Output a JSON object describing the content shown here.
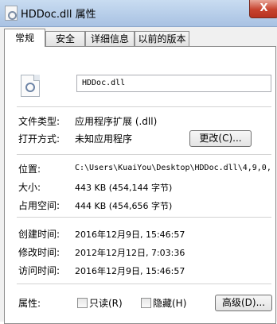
{
  "window": {
    "title": "HDDoc.dll 属性",
    "close_glyph": "X"
  },
  "tabs": [
    {
      "label": "常规",
      "active": true
    },
    {
      "label": "安全",
      "active": false
    },
    {
      "label": "详细信息",
      "active": false
    },
    {
      "label": "以前的版本",
      "active": false
    }
  ],
  "general": {
    "filename": "HDDoc.dll",
    "file_type_label": "文件类型:",
    "file_type_value": "应用程序扩展 (.dll)",
    "opens_with_label": "打开方式:",
    "opens_with_value": "未知应用程序",
    "change_button": "更改(C)...",
    "location_label": "位置:",
    "location_value": "C:\\Users\\KuaiYou\\Desktop\\HDDoc.dll\\4,9,0,",
    "size_label": "大小:",
    "size_value": "443 KB (454,144 字节)",
    "size_on_disk_label": "占用空间:",
    "size_on_disk_value": "444 KB (454,656 字节)",
    "created_label": "创建时间:",
    "created_value": "2016年12月9日, 15:46:57",
    "modified_label": "修改时间:",
    "modified_value": "2012年12月12日, 7:03:36",
    "accessed_label": "访问时间:",
    "accessed_value": "2016年12月9日, 15:46:57",
    "attributes_label": "属性:",
    "readonly_label": "只读(R)",
    "hidden_label": "隐藏(H)",
    "advanced_button": "高级(D)..."
  }
}
